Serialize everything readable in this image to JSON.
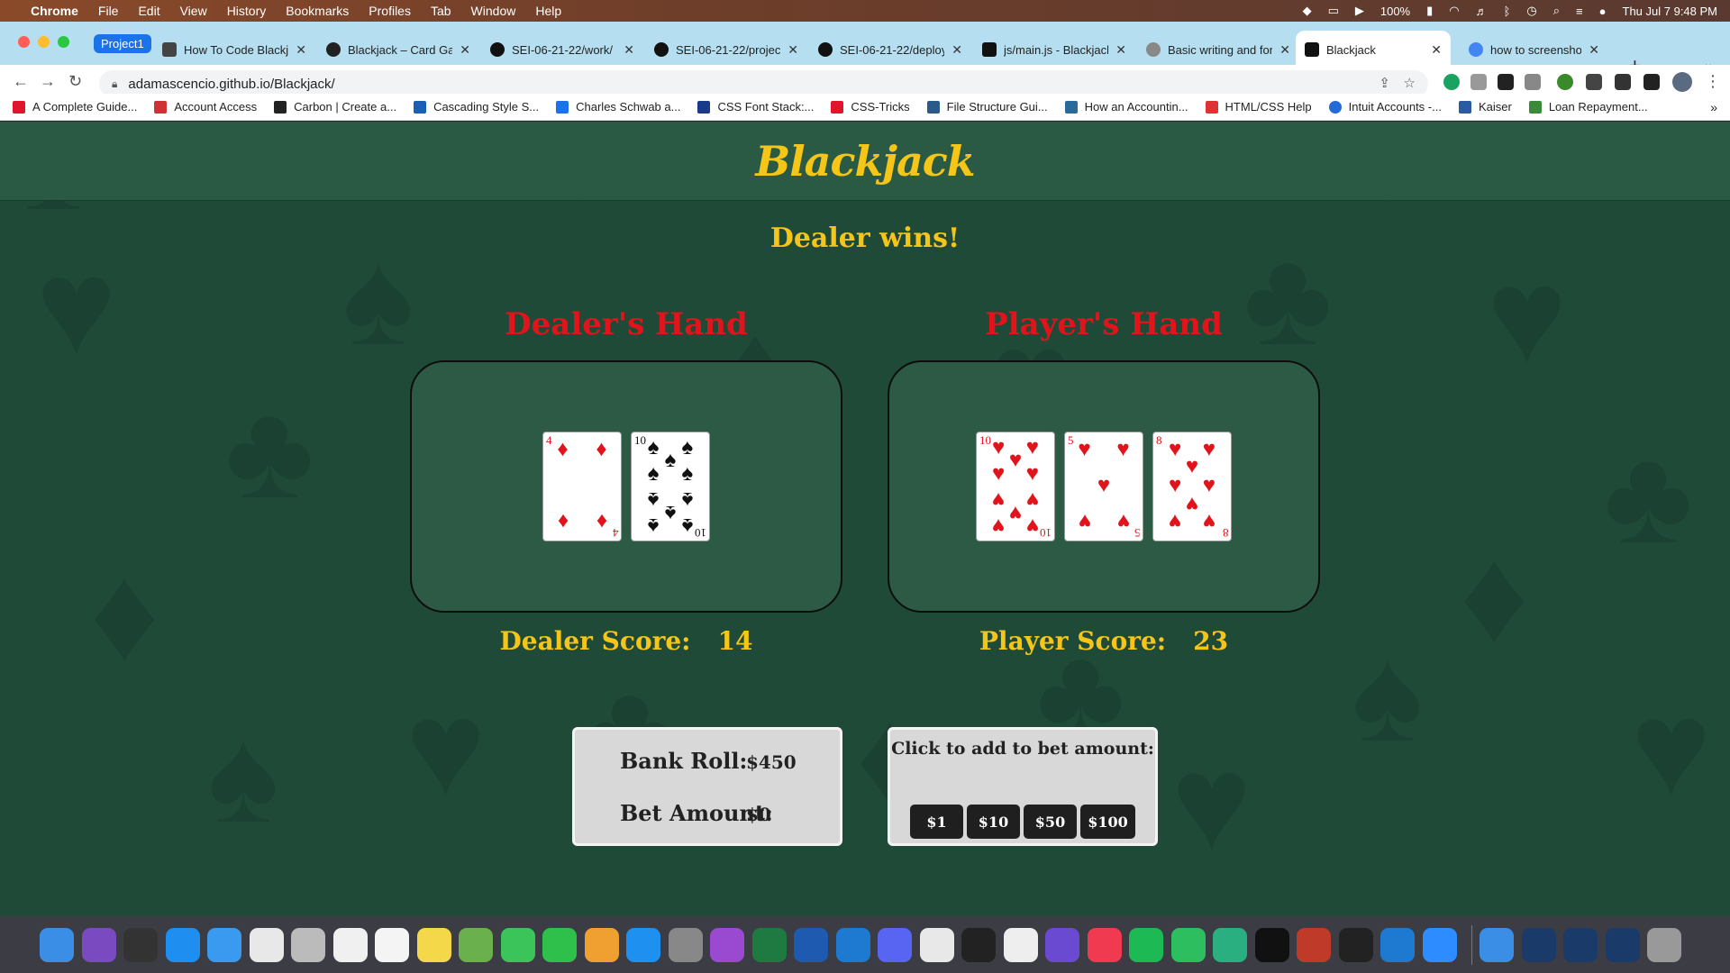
{
  "menubar": {
    "app": "Chrome",
    "items": [
      "File",
      "Edit",
      "View",
      "History",
      "Bookmarks",
      "Profiles",
      "Tab",
      "Window",
      "Help"
    ],
    "battery": "100%",
    "datetime": "Thu Jul 7  9:48 PM"
  },
  "tabs": {
    "group_label": "Project1",
    "items": [
      {
        "title": "How To Code Blackja",
        "color": "#444444"
      },
      {
        "title": "Blackjack – Card Gam",
        "color": "#222222"
      },
      {
        "title": "SEI-06-21-22/work/",
        "color": "#111111"
      },
      {
        "title": "SEI-06-21-22/projec",
        "color": "#111111"
      },
      {
        "title": "SEI-06-21-22/deploy",
        "color": "#111111"
      },
      {
        "title": "js/main.js - Blackjack",
        "color": "#111111"
      },
      {
        "title": "Basic writing and for",
        "color": "#888888"
      },
      {
        "title": "Blackjack",
        "color": "#111111"
      },
      {
        "title": "how to screenshot o",
        "color": "#4285f4"
      }
    ]
  },
  "address": {
    "url": "adamascencio.github.io/Blackjack/"
  },
  "bookmarks": [
    {
      "label": "A Complete Guide...",
      "color": "#e0142a"
    },
    {
      "label": "Account Access",
      "color": "#c33"
    },
    {
      "label": "Carbon | Create a...",
      "color": "#222"
    },
    {
      "label": "Cascading Style S...",
      "color": "#1a5fb4"
    },
    {
      "label": "Charles Schwab a...",
      "color": "#1a73e8"
    },
    {
      "label": "CSS Font Stack:...",
      "color": "#1a3a8a"
    },
    {
      "label": "CSS-Tricks",
      "color": "#e0142a"
    },
    {
      "label": "File Structure Gui...",
      "color": "#2a5a8a"
    },
    {
      "label": "How an Accountin...",
      "color": "#2a6a9a"
    },
    {
      "label": "HTML/CSS Help",
      "color": "#d33"
    },
    {
      "label": "Intuit Accounts -...",
      "color": "#2369d8"
    },
    {
      "label": "Kaiser",
      "color": "#2a5aa0"
    },
    {
      "label": "Loan Repayment...",
      "color": "#3a8a3a"
    }
  ],
  "game": {
    "title": "Blackjack",
    "message": "Dealer wins!",
    "dealer": {
      "heading": "Dealer's Hand",
      "score_label": "Dealer Score:",
      "score": "14",
      "cards": [
        {
          "rank": "4",
          "suit": "♦",
          "color": "red"
        },
        {
          "rank": "10",
          "suit": "♠",
          "color": "black"
        }
      ]
    },
    "player": {
      "heading": "Player's Hand",
      "score_label": "Player Score:",
      "score": "23",
      "cards": [
        {
          "rank": "10",
          "suit": "♥",
          "color": "red"
        },
        {
          "rank": "5",
          "suit": "♥",
          "color": "red"
        },
        {
          "rank": "8",
          "suit": "♥",
          "color": "red"
        }
      ]
    },
    "bankroll_label": "Bank Roll:",
    "bankroll": "$450",
    "bet_label": "Bet Amount:",
    "bet": "$0",
    "chip_prompt": "Click to add to bet amount:",
    "chips": [
      "$1",
      "$10",
      "$50",
      "$100"
    ],
    "colors": {
      "accent": "#f5c518",
      "heading": "#e0141a",
      "felt": "#1f4a38"
    }
  },
  "dock": {
    "apps": [
      {
        "name": "finder-icon",
        "color": "#3a8ee6"
      },
      {
        "name": "siri-icon",
        "color": "#7a4ac0"
      },
      {
        "name": "mission-control-icon",
        "color": "#333"
      },
      {
        "name": "safari-icon",
        "color": "#1e8ef0"
      },
      {
        "name": "mail-icon",
        "color": "#3a9af0"
      },
      {
        "name": "chrome-icon",
        "color": "#e8e8e8"
      },
      {
        "name": "launchpad-icon",
        "color": "#bbb"
      },
      {
        "name": "calendar-icon",
        "color": "#f0f0f0"
      },
      {
        "name": "reminders-icon",
        "color": "#f4f4f4"
      },
      {
        "name": "notes-icon",
        "color": "#f5d84a"
      },
      {
        "name": "maps-icon",
        "color": "#6ab04c"
      },
      {
        "name": "messages-icon",
        "color": "#3ac45a"
      },
      {
        "name": "facetime-icon",
        "color": "#2ec04a"
      },
      {
        "name": "photos-icon",
        "color": "#f0a030"
      },
      {
        "name": "app-store-icon",
        "color": "#1e90f0"
      },
      {
        "name": "system-preferences-icon",
        "color": "#888"
      },
      {
        "name": "podcasts-icon",
        "color": "#9a4ad0"
      },
      {
        "name": "excel-icon",
        "color": "#1e7a40"
      },
      {
        "name": "word-icon",
        "color": "#1e5ab0"
      },
      {
        "name": "vscode-icon",
        "color": "#1e7ad0"
      },
      {
        "name": "discord-icon",
        "color": "#5865f2"
      },
      {
        "name": "slack-icon",
        "color": "#e8e8e8"
      },
      {
        "name": "figma-icon",
        "color": "#222"
      },
      {
        "name": "finder-face-icon",
        "color": "#eee"
      },
      {
        "name": "stack-icon",
        "color": "#6a4ad0"
      },
      {
        "name": "music-icon",
        "color": "#f03a50"
      },
      {
        "name": "spotify-icon",
        "color": "#1db954"
      },
      {
        "name": "evernote-icon",
        "color": "#2dbe60"
      },
      {
        "name": "vpn-icon",
        "color": "#2ab080"
      },
      {
        "name": "terminal-icon",
        "color": "#111"
      },
      {
        "name": "instruments-icon",
        "color": "#c03a2a"
      },
      {
        "name": "activity-monitor-icon",
        "color": "#222"
      },
      {
        "name": "vscode-2-icon",
        "color": "#1e7ad0"
      },
      {
        "name": "zoom-icon",
        "color": "#2d8cff"
      },
      {
        "name": "downloads-icon",
        "color": "#3a8ee6"
      },
      {
        "name": "window-1-icon",
        "color": "#1a3a6a"
      },
      {
        "name": "window-2-icon",
        "color": "#1a3a6a"
      },
      {
        "name": "window-3-icon",
        "color": "#1a3a6a"
      },
      {
        "name": "trash-icon",
        "color": "#999"
      }
    ]
  }
}
